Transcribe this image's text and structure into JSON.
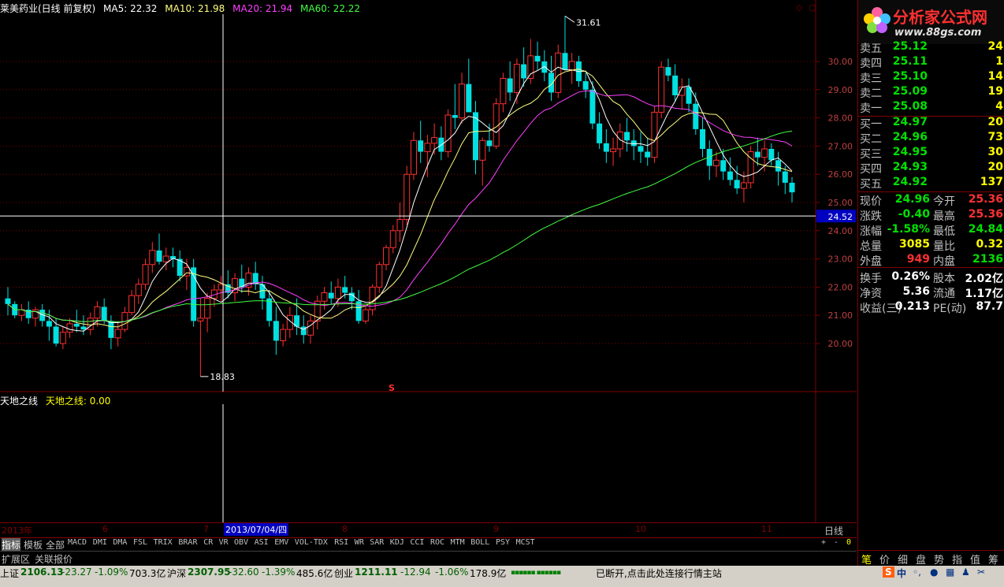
{
  "header": {
    "stock_title": "莱美药业(日线 前复权)",
    "ma5": "MA5: 22.32",
    "ma10": "MA10: 21.98",
    "ma20": "MA20: 21.94",
    "ma60": "MA60: 22.22"
  },
  "indicator": {
    "name": "天地之线",
    "value_label": "天地之线: 0.00"
  },
  "price_axis": [
    "30.00",
    "29.00",
    "28.00",
    "27.00",
    "26.00",
    "25.00",
    "24.00",
    "23.00",
    "22.00",
    "21.00",
    "20.00"
  ],
  "crosshair_price": "24.52",
  "annotations": {
    "high": "31.61",
    "low": "18.83",
    "s_marker": "S"
  },
  "date_axis": {
    "labels": [
      "2013年",
      "6",
      "7",
      "8",
      "9",
      "10",
      "11"
    ],
    "cursor_date": "2013/07/04/四",
    "period": "日线"
  },
  "tabs": [
    "指标",
    "模板",
    "全部",
    "MACD",
    "DMI",
    "DMA",
    "FSL",
    "TRIX",
    "BRAR",
    "CR",
    "VR",
    "OBV",
    "ASI",
    "EMV",
    "VOL-TDX",
    "RSI",
    "WR",
    "SAR",
    "KDJ",
    "CCI",
    "ROC",
    "MTM",
    "BOLL",
    "PSY",
    "MCST"
  ],
  "tab_controls": {
    "plus": "+",
    "minus": "-",
    "zero": "0"
  },
  "ext_bar": {
    "ext": "扩展区",
    "related": "关联报价"
  },
  "logo": {
    "text": "分析家公式网",
    "url": "www.88gs.com"
  },
  "order_book": {
    "sell": [
      {
        "label": "卖五",
        "price": "25.12",
        "vol": "24"
      },
      {
        "label": "卖四",
        "price": "25.11",
        "vol": "1"
      },
      {
        "label": "卖三",
        "price": "25.10",
        "vol": "14"
      },
      {
        "label": "卖二",
        "price": "25.09",
        "vol": "19"
      },
      {
        "label": "卖一",
        "price": "25.08",
        "vol": "4"
      }
    ],
    "buy": [
      {
        "label": "买一",
        "price": "24.97",
        "vol": "20"
      },
      {
        "label": "买二",
        "price": "24.96",
        "vol": "73"
      },
      {
        "label": "买三",
        "price": "24.95",
        "vol": "30"
      },
      {
        "label": "买四",
        "price": "24.93",
        "vol": "20"
      },
      {
        "label": "买五",
        "price": "24.92",
        "vol": "137"
      }
    ]
  },
  "quote": [
    {
      "l1": "现价",
      "v1": "24.96",
      "l2": "今开",
      "v2": "25.36"
    },
    {
      "l1": "涨跌",
      "v1": "-0.40",
      "l2": "最高",
      "v2": "25.36"
    },
    {
      "l1": "涨幅",
      "v1": "-1.58%",
      "l2": "最低",
      "v2": "24.84"
    },
    {
      "l1": "总量",
      "v1": "3085",
      "l2": "量比",
      "v2": "0.32"
    },
    {
      "l1": "外盘",
      "v1": "949",
      "l2": "内盘",
      "v2": "2136"
    }
  ],
  "finance": [
    {
      "l1": "换手",
      "v1": "0.26%",
      "l2": "股本",
      "v2": "2.02亿"
    },
    {
      "l1": "净资",
      "v1": "5.36",
      "l2": "流通",
      "v2": "1.17亿"
    },
    {
      "l1": "收益(三)",
      "v1": "0.213",
      "l2": "PE(动)",
      "v2": "87.7"
    }
  ],
  "side_tabs": [
    "笔",
    "价",
    "细",
    "盘",
    "势",
    "指",
    "值",
    "筹"
  ],
  "status": {
    "sh": "上证",
    "sh_val": "2106.13",
    "sh_chg": "-23.27",
    "sh_pct": "-1.09%",
    "sh_amt": "703.3亿",
    "sz": "沪深",
    "sz_val": "2307.95",
    "sz_chg": "-32.60",
    "sz_pct": "-1.39%",
    "sz_amt": "485.6亿",
    "cy": "创业",
    "cy_val": "1211.11",
    "cy_chg": "-12.94",
    "cy_pct": "-1.06%",
    "cy_amt": "178.9亿",
    "msg": "已断开,点击此处连接行情主站"
  },
  "colors": {
    "up": "#ff3030",
    "down": "#00e0e0",
    "ma5": "#ffffff",
    "ma10": "#ffff80",
    "ma20": "#ff40ff",
    "ma60": "#40ff40",
    "grid": "#800000"
  },
  "chart_data": {
    "type": "candlestick",
    "ylim": [
      19.0,
      32.0
    ],
    "candles": [
      [
        21.6,
        22.0,
        21.0,
        21.4
      ],
      [
        21.4,
        21.5,
        20.9,
        21.0
      ],
      [
        21.0,
        21.4,
        20.8,
        21.2
      ],
      [
        21.2,
        21.5,
        20.7,
        20.9
      ],
      [
        20.9,
        21.3,
        20.6,
        21.2
      ],
      [
        21.2,
        21.4,
        20.6,
        20.8
      ],
      [
        20.8,
        21.2,
        20.1,
        20.6
      ],
      [
        20.6,
        20.9,
        19.9,
        20.0
      ],
      [
        20.0,
        20.6,
        19.8,
        20.4
      ],
      [
        20.4,
        20.9,
        20.2,
        20.7
      ],
      [
        20.7,
        21.2,
        20.4,
        20.6
      ],
      [
        20.6,
        21.0,
        20.3,
        20.5
      ],
      [
        20.5,
        21.1,
        20.3,
        20.9
      ],
      [
        20.9,
        21.5,
        20.6,
        21.3
      ],
      [
        21.3,
        21.6,
        20.7,
        20.8
      ],
      [
        20.8,
        21.0,
        19.8,
        20.2
      ],
      [
        20.2,
        20.8,
        19.9,
        20.5
      ],
      [
        20.5,
        21.3,
        20.4,
        21.1
      ],
      [
        21.1,
        21.9,
        21.0,
        21.7
      ],
      [
        21.7,
        22.3,
        21.4,
        22.1
      ],
      [
        22.1,
        23.0,
        21.9,
        22.8
      ],
      [
        22.8,
        23.6,
        22.5,
        23.3
      ],
      [
        23.3,
        23.9,
        22.8,
        22.9
      ],
      [
        22.9,
        23.4,
        22.6,
        23.1
      ],
      [
        23.1,
        23.4,
        22.7,
        23.0
      ],
      [
        23.0,
        23.3,
        22.2,
        22.4
      ],
      [
        22.4,
        23.0,
        21.9,
        22.7
      ],
      [
        22.7,
        23.0,
        20.6,
        20.8
      ],
      [
        20.8,
        21.6,
        18.83,
        20.9
      ],
      [
        20.9,
        21.8,
        20.4,
        21.6
      ],
      [
        21.6,
        22.1,
        21.3,
        21.9
      ],
      [
        21.9,
        22.4,
        21.5,
        22.1
      ],
      [
        22.1,
        22.6,
        21.6,
        21.8
      ],
      [
        21.8,
        22.5,
        21.5,
        22.3
      ],
      [
        22.3,
        22.8,
        21.8,
        22.0
      ],
      [
        22.0,
        22.7,
        21.7,
        22.5
      ],
      [
        22.5,
        22.9,
        21.9,
        22.1
      ],
      [
        22.1,
        22.4,
        21.2,
        21.6
      ],
      [
        21.6,
        21.9,
        20.6,
        20.8
      ],
      [
        20.8,
        21.3,
        19.6,
        20.1
      ],
      [
        20.1,
        20.7,
        19.9,
        20.5
      ],
      [
        20.5,
        21.3,
        20.2,
        21.0
      ],
      [
        21.0,
        21.6,
        20.3,
        20.6
      ],
      [
        20.6,
        21.0,
        20.0,
        20.3
      ],
      [
        20.3,
        21.0,
        20.0,
        20.8
      ],
      [
        20.8,
        21.7,
        20.5,
        21.5
      ],
      [
        21.5,
        22.0,
        21.2,
        21.8
      ],
      [
        21.8,
        22.2,
        21.4,
        21.6
      ],
      [
        21.6,
        22.3,
        21.3,
        22.0
      ],
      [
        22.0,
        22.4,
        21.6,
        21.8
      ],
      [
        21.8,
        22.0,
        21.2,
        21.5
      ],
      [
        21.5,
        21.9,
        20.7,
        20.8
      ],
      [
        20.8,
        21.3,
        20.7,
        21.2
      ],
      [
        21.2,
        22.1,
        21.0,
        22.0
      ],
      [
        22.0,
        22.9,
        21.8,
        22.8
      ],
      [
        22.8,
        23.5,
        22.6,
        23.4
      ],
      [
        23.4,
        24.2,
        23.2,
        24.0
      ],
      [
        24.0,
        25.0,
        23.6,
        24.4
      ],
      [
        24.4,
        26.3,
        24.2,
        26.0
      ],
      [
        26.0,
        27.5,
        25.8,
        27.2
      ],
      [
        27.2,
        27.9,
        26.4,
        26.8
      ],
      [
        26.8,
        27.4,
        25.9,
        27.1
      ],
      [
        27.1,
        27.8,
        26.7,
        27.3
      ],
      [
        27.3,
        27.7,
        26.5,
        26.8
      ],
      [
        26.8,
        28.3,
        26.6,
        28.1
      ],
      [
        28.1,
        29.2,
        27.6,
        28.0
      ],
      [
        28.0,
        29.6,
        27.8,
        29.2
      ],
      [
        29.2,
        30.1,
        28.4,
        28.2
      ],
      [
        28.2,
        28.6,
        26.0,
        26.5
      ],
      [
        26.5,
        27.3,
        25.6,
        27.2
      ],
      [
        27.2,
        27.8,
        26.8,
        27.0
      ],
      [
        27.0,
        28.7,
        26.9,
        28.5
      ],
      [
        28.5,
        29.6,
        28.2,
        29.4
      ],
      [
        29.4,
        30.0,
        28.6,
        28.9
      ],
      [
        28.9,
        30.1,
        28.5,
        29.9
      ],
      [
        29.9,
        30.5,
        29.1,
        29.4
      ],
      [
        29.4,
        30.8,
        29.2,
        30.2
      ],
      [
        30.2,
        30.7,
        29.7,
        30.0
      ],
      [
        30.0,
        30.4,
        29.3,
        29.6
      ],
      [
        29.6,
        30.2,
        28.6,
        28.9
      ],
      [
        28.9,
        30.6,
        28.7,
        30.3
      ],
      [
        30.3,
        31.61,
        29.8,
        29.7
      ],
      [
        29.7,
        30.3,
        29.2,
        30.0
      ],
      [
        30.0,
        30.2,
        29.1,
        29.3
      ],
      [
        29.3,
        29.6,
        28.7,
        29.0
      ],
      [
        29.0,
        29.3,
        27.6,
        27.8
      ],
      [
        27.8,
        28.2,
        26.9,
        27.1
      ],
      [
        27.1,
        27.6,
        26.4,
        26.8
      ],
      [
        26.8,
        27.3,
        26.3,
        26.9
      ],
      [
        26.9,
        27.8,
        26.6,
        27.5
      ],
      [
        27.5,
        28.0,
        26.8,
        27.2
      ],
      [
        27.2,
        27.6,
        26.5,
        27.0
      ],
      [
        27.0,
        27.5,
        26.4,
        26.8
      ],
      [
        26.8,
        27.3,
        26.3,
        26.6
      ],
      [
        26.6,
        28.4,
        26.4,
        28.2
      ],
      [
        28.2,
        30.0,
        28.0,
        29.8
      ],
      [
        29.8,
        30.1,
        29.3,
        29.5
      ],
      [
        29.5,
        29.9,
        28.6,
        28.8
      ],
      [
        28.8,
        29.4,
        28.3,
        29.1
      ],
      [
        29.1,
        29.4,
        28.2,
        28.5
      ],
      [
        28.5,
        28.9,
        27.4,
        27.6
      ],
      [
        27.6,
        28.0,
        26.6,
        26.9
      ],
      [
        26.9,
        27.2,
        25.8,
        26.3
      ],
      [
        26.3,
        26.8,
        25.9,
        26.5
      ],
      [
        26.5,
        26.9,
        25.8,
        26.1
      ],
      [
        26.1,
        26.6,
        25.6,
        25.8
      ],
      [
        25.8,
        26.3,
        25.3,
        25.5
      ],
      [
        25.5,
        26.1,
        25.0,
        25.7
      ],
      [
        25.7,
        27.0,
        25.5,
        26.8
      ],
      [
        26.8,
        27.3,
        26.3,
        26.6
      ],
      [
        26.6,
        27.2,
        26.1,
        26.9
      ],
      [
        26.9,
        27.1,
        26.3,
        26.5
      ],
      [
        26.5,
        26.8,
        25.6,
        26.1
      ],
      [
        26.1,
        26.3,
        25.3,
        25.7
      ],
      [
        25.7,
        25.9,
        25.0,
        25.36
      ]
    ]
  }
}
